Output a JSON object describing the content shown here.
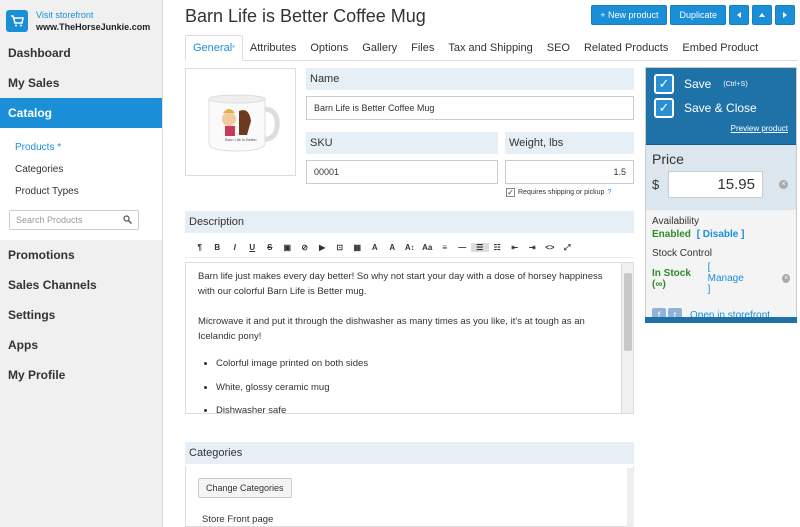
{
  "sidebar": {
    "visit_label": "Visit storefront",
    "site_name": "www.TheHorseJunkie.com",
    "items_top": [
      "Dashboard",
      "My Sales",
      "Catalog"
    ],
    "sub_items": [
      "Products *",
      "Categories",
      "Product Types"
    ],
    "search_placeholder": "Search Products",
    "items_bottom": [
      "Promotions",
      "Sales Channels",
      "Settings",
      "Apps",
      "My Profile"
    ]
  },
  "header": {
    "title": "Barn Life is Better Coffee Mug",
    "new_product_label": "+ New product",
    "duplicate_label": "Duplicate"
  },
  "tabs": {
    "general": "General",
    "general_marker": "*",
    "rest": [
      "Attributes",
      "Options",
      "Gallery",
      "Files",
      "Tax and Shipping",
      "SEO",
      "Related Products",
      "Embed Product"
    ]
  },
  "form": {
    "name_label": "Name",
    "name_value": "Barn Life is Better Coffee Mug",
    "sku_label": "SKU",
    "sku_value": "00001",
    "weight_label": "Weight, lbs",
    "weight_value": "1.5",
    "shipping_label": "Requires shipping or pickup",
    "shipping_checked": true
  },
  "description": {
    "label": "Description",
    "para1": "Barn life just makes every day better! So why not start your day with a dose of horsey happiness with our colorful Barn Life is Better mug.",
    "para2": "Microwave it and put it through the dishwasher as many times as you like, it's at tough as an Icelandic pony!",
    "bullets": [
      "Colorful image printed on both sides",
      "White, glossy ceramic mug",
      "Dishwasher safe"
    ]
  },
  "categories": {
    "label": "Categories",
    "change_label": "Change Categories",
    "first_item": "Store Front page"
  },
  "panel": {
    "save_label": "Save",
    "save_shortcut": "(Ctrl+S)",
    "save_close_label": "Save & Close",
    "preview_label": "Preview product",
    "price_label": "Price",
    "currency": "$",
    "price_value": "15.95",
    "availability_label": "Availability",
    "availability_status": "Enabled",
    "disable_link": "[ Disable ]",
    "stock_label": "Stock Control",
    "stock_status": "In Stock (∞)",
    "manage_link": "[ Manage ]",
    "open_storefront": "Open in storefront"
  },
  "colors": {
    "accent": "#1a8fd8",
    "save_panel": "#1e72a8",
    "enabled": "#2e8b2e"
  }
}
